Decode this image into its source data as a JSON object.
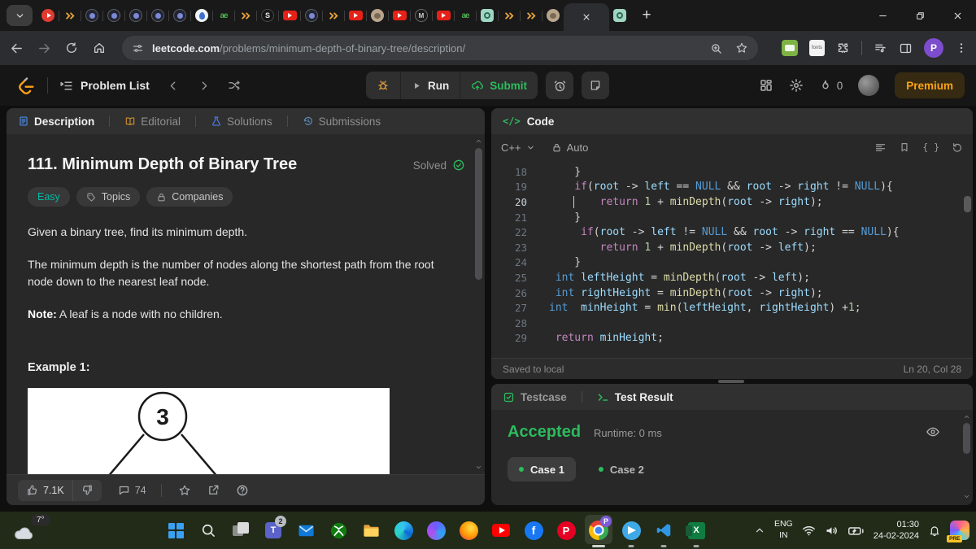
{
  "colors": {
    "accepted_green": "#2cbb5d",
    "easy_teal": "#00b8a3",
    "premium_orange": "#ffa116",
    "submit_green": "#2cbb5d"
  },
  "browser": {
    "url": {
      "domain": "leetcode.com",
      "path": "/problems/minimum-depth-of-binary-tree/description/"
    },
    "pinned_tabs": [
      "ytm",
      "arrows",
      "dim",
      "dim",
      "dim",
      "dim",
      "dim",
      "flame",
      "ae",
      "arrows",
      "globe",
      "yt",
      "dim",
      "arrows",
      "yt",
      "monkey",
      "yt",
      "m",
      "yt",
      "ae",
      "gpt",
      "arrows",
      "arrows",
      "monkey"
    ],
    "after_active": [
      "gpt"
    ],
    "profile_initial": "P",
    "ext_fonts_label": "fonts"
  },
  "nav": {
    "problem_list": "Problem List",
    "run_label": "Run",
    "submit_label": "Submit",
    "streak_count": "0",
    "premium_label": "Premium"
  },
  "panel_tabs": {
    "description": "Description",
    "editorial": "Editorial",
    "solutions": "Solutions",
    "submissions": "Submissions"
  },
  "problem": {
    "title": "111. Minimum Depth of Binary Tree",
    "solved_label": "Solved",
    "difficulty": "Easy",
    "topics_label": "Topics",
    "companies_label": "Companies",
    "para1": "Given a binary tree, find its minimum depth.",
    "para2": "The minimum depth is the number of nodes along the shortest path from the root node down to the nearest leaf node.",
    "note_label": "Note:",
    "note_text": " A leaf is a node with no children.",
    "example_label": "Example 1:",
    "tree_root_value": "3"
  },
  "footer": {
    "likes": "7.1K",
    "comments": "74"
  },
  "editor": {
    "panel_title": "Code",
    "language": "C++",
    "autocomplete_label": "Auto",
    "braces_glyph": "{ }",
    "status_saved": "Saved to local",
    "status_cursor": "Ln 20, Col 28",
    "lines": [
      {
        "n": "18",
        "tokens": [
          [
            "o",
            "    }"
          ]
        ]
      },
      {
        "n": "19",
        "tokens": [
          [
            "o",
            "    "
          ],
          [
            "k",
            "if"
          ],
          [
            "o",
            "("
          ],
          [
            "v",
            "root"
          ],
          [
            "o",
            " -> "
          ],
          [
            "v",
            "left"
          ],
          [
            "o",
            " == "
          ],
          [
            "t",
            "NULL"
          ],
          [
            "o",
            " && "
          ],
          [
            "v",
            "root"
          ],
          [
            "o",
            " -> "
          ],
          [
            "v",
            "right"
          ],
          [
            "o",
            " != "
          ],
          [
            "t",
            "NULL"
          ],
          [
            "o",
            "){"
          ]
        ]
      },
      {
        "n": "20",
        "active": true,
        "tokens": [
          [
            "o",
            "    "
          ],
          [
            "caret",
            ""
          ],
          [
            "o",
            "    "
          ],
          [
            "k",
            "return"
          ],
          [
            "o",
            " "
          ],
          [
            "n",
            "1"
          ],
          [
            "o",
            " + "
          ],
          [
            "f",
            "minDepth"
          ],
          [
            "o",
            "("
          ],
          [
            "v",
            "root"
          ],
          [
            "o",
            " -> "
          ],
          [
            "v",
            "right"
          ],
          [
            "o",
            ");"
          ]
        ]
      },
      {
        "n": "21",
        "tokens": [
          [
            "o",
            "    }"
          ]
        ]
      },
      {
        "n": "22",
        "tokens": [
          [
            "o",
            "     "
          ],
          [
            "k",
            "if"
          ],
          [
            "o",
            "("
          ],
          [
            "v",
            "root"
          ],
          [
            "o",
            " -> "
          ],
          [
            "v",
            "left"
          ],
          [
            "o",
            " != "
          ],
          [
            "t",
            "NULL"
          ],
          [
            "o",
            " && "
          ],
          [
            "v",
            "root"
          ],
          [
            "o",
            " -> "
          ],
          [
            "v",
            "right"
          ],
          [
            "o",
            " == "
          ],
          [
            "t",
            "NULL"
          ],
          [
            "o",
            "){"
          ]
        ]
      },
      {
        "n": "23",
        "tokens": [
          [
            "o",
            "        "
          ],
          [
            "k",
            "return"
          ],
          [
            "o",
            " "
          ],
          [
            "n",
            "1"
          ],
          [
            "o",
            " + "
          ],
          [
            "f",
            "minDepth"
          ],
          [
            "o",
            "("
          ],
          [
            "v",
            "root"
          ],
          [
            "o",
            " -> "
          ],
          [
            "v",
            "left"
          ],
          [
            "o",
            ");"
          ]
        ]
      },
      {
        "n": "24",
        "tokens": [
          [
            "o",
            "    }"
          ]
        ]
      },
      {
        "n": "25",
        "tokens": [
          [
            "o",
            " "
          ],
          [
            "t",
            "int"
          ],
          [
            "o",
            " "
          ],
          [
            "v",
            "leftHeight"
          ],
          [
            "o",
            " = "
          ],
          [
            "f",
            "minDepth"
          ],
          [
            "o",
            "("
          ],
          [
            "v",
            "root"
          ],
          [
            "o",
            " -> "
          ],
          [
            "v",
            "left"
          ],
          [
            "o",
            ");"
          ]
        ]
      },
      {
        "n": "26",
        "tokens": [
          [
            "o",
            " "
          ],
          [
            "t",
            "int"
          ],
          [
            "o",
            " "
          ],
          [
            "v",
            "rightHeight"
          ],
          [
            "o",
            " = "
          ],
          [
            "f",
            "minDepth"
          ],
          [
            "o",
            "("
          ],
          [
            "v",
            "root"
          ],
          [
            "o",
            " -> "
          ],
          [
            "v",
            "right"
          ],
          [
            "o",
            ");"
          ]
        ]
      },
      {
        "n": "27",
        "tokens": [
          [
            "t",
            "int"
          ],
          [
            "o",
            "  "
          ],
          [
            "v",
            "minHeight"
          ],
          [
            "o",
            " = "
          ],
          [
            "f",
            "min"
          ],
          [
            "o",
            "("
          ],
          [
            "v",
            "leftHeight"
          ],
          [
            "o",
            ", "
          ],
          [
            "v",
            "rightHeight"
          ],
          [
            "o",
            ") +"
          ],
          [
            "n",
            "1"
          ],
          [
            "o",
            ";"
          ]
        ]
      },
      {
        "n": "28",
        "tokens": []
      },
      {
        "n": "29",
        "tokens": [
          [
            "o",
            " "
          ],
          [
            "k",
            "return"
          ],
          [
            "o",
            " "
          ],
          [
            "v",
            "minHeight"
          ],
          [
            "o",
            ";"
          ]
        ]
      }
    ]
  },
  "console": {
    "tab_testcase": "Testcase",
    "tab_result": "Test Result",
    "verdict": "Accepted",
    "runtime": "Runtime: 0 ms",
    "case1": "Case 1",
    "case2": "Case 2"
  },
  "taskbar": {
    "weather_temp": "7°",
    "icons": [
      {
        "t": "start"
      },
      {
        "t": "search"
      },
      {
        "t": "taskview"
      },
      {
        "t": "teams",
        "badge": "2"
      },
      {
        "t": "mail"
      },
      {
        "t": "xbox"
      },
      {
        "t": "explorer"
      },
      {
        "t": "edge"
      },
      {
        "t": "copilot"
      },
      {
        "t": "firefox"
      },
      {
        "t": "youtube"
      },
      {
        "t": "facebook"
      },
      {
        "t": "pinterest"
      },
      {
        "t": "chrome",
        "badge": "P",
        "active": true,
        "dot": true
      },
      {
        "t": "telegram",
        "dot": true
      },
      {
        "t": "vscode",
        "dot": true
      },
      {
        "t": "excel",
        "dot": true
      }
    ],
    "lang_line1": "ENG",
    "lang_line2": "IN",
    "time": "01:30",
    "date": "24-02-2024",
    "copilot_badge": "PRE"
  }
}
